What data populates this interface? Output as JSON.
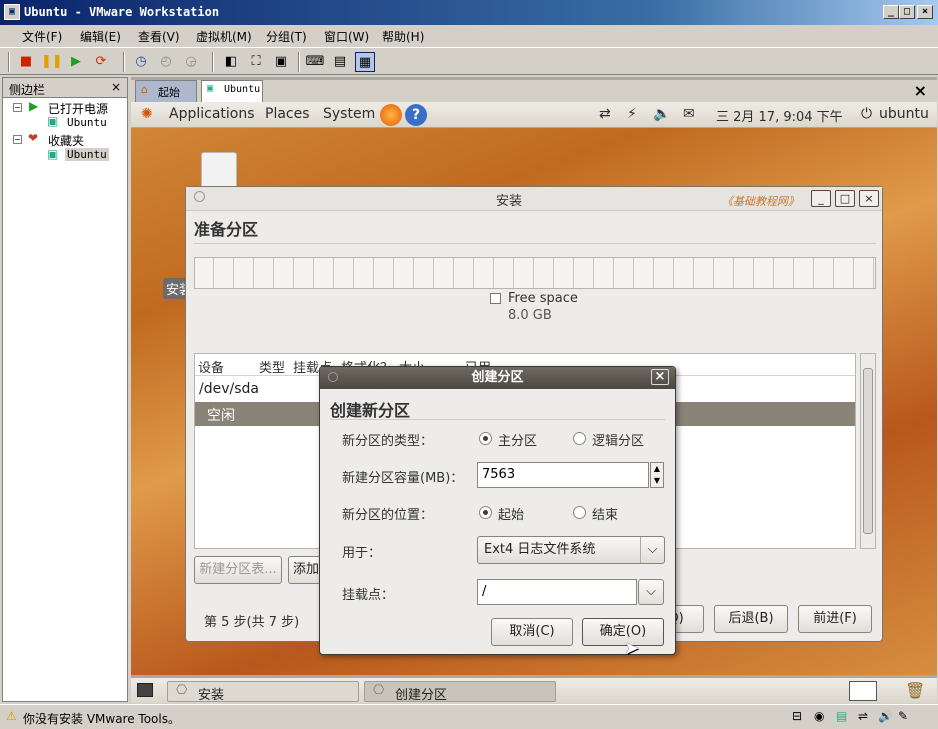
{
  "window": {
    "title": "Ubuntu - VMware Workstation"
  },
  "menu": [
    "文件(F)",
    "编辑(E)",
    "查看(V)",
    "虚拟机(M)",
    "分组(T)",
    "窗口(W)",
    "帮助(H)"
  ],
  "sidebar": {
    "title": "侧边栏",
    "powered_on": "已打开电源",
    "vm1": "Ubuntu",
    "favorites": "收藏夹",
    "vm2": "Ubuntu"
  },
  "tabs": {
    "home": "起始页",
    "vm": "Ubuntu"
  },
  "gnome_panel": {
    "applications": "Applications",
    "places": "Places",
    "system": "System",
    "clock": "三 2月 17, 9:04 下午",
    "user": "ubuntu"
  },
  "installer": {
    "title": "安装",
    "watermark": "《基础教程网》",
    "heading": "准备分区",
    "free_space_label": "Free space",
    "free_space_size": "8.0 GB",
    "columns": [
      "设备",
      "类型",
      "挂载点",
      "格式化？",
      "大小",
      "已用"
    ],
    "rows": [
      "/dev/sda",
      "空闲"
    ],
    "new_table_button": "新建分区表...",
    "add_button": "添加",
    "step": "第 5 步(共 7 步)",
    "quit_button": "Q)",
    "back_button": "后退(B)",
    "forward_button": "前进(F)"
  },
  "desktop_icon_label": "安装",
  "dialog": {
    "title": "创建分区",
    "heading": "创建新分区",
    "type_label": "新分区的类型：",
    "type_primary": "主分区",
    "type_logical": "逻辑分区",
    "size_label": "新建分区容量(MB)：",
    "size_value": "7563",
    "location_label": "新分区的位置：",
    "loc_begin": "起始",
    "loc_end": "结束",
    "use_label": "用于：",
    "use_value": "Ext4 日志文件系统",
    "mount_label": "挂载点：",
    "mount_value": "/",
    "cancel": "取消(C)",
    "ok": "确定(O)"
  },
  "taskbar": {
    "item1": "安装",
    "item2": "创建分区"
  },
  "statusbar": {
    "message": "你没有安装 VMware Tools。"
  }
}
